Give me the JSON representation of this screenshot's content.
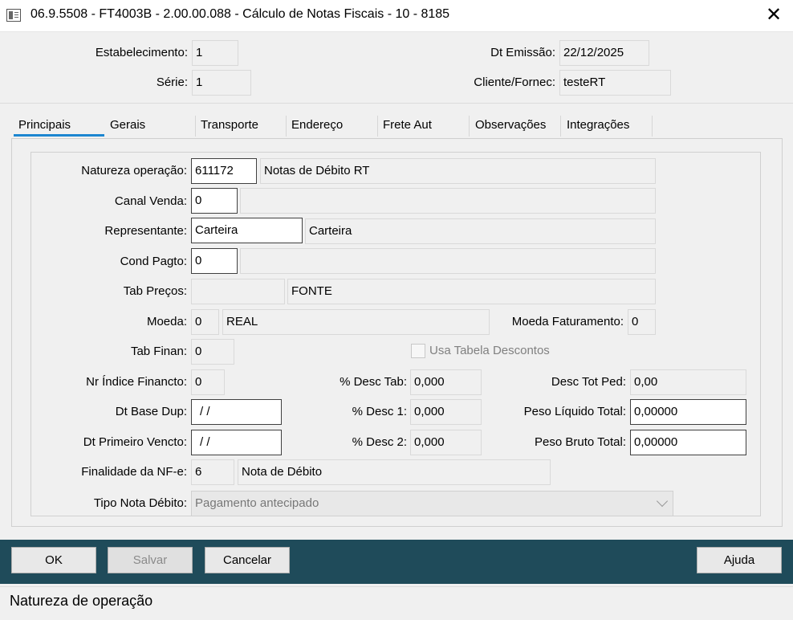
{
  "window": {
    "title": "06.9.5508 - FT4003B - 2.00.00.088 - Cálculo de Notas Fiscais - 10 - 8185",
    "close_glyph": "✕"
  },
  "header": {
    "estabelecimento_label": "Estabelecimento:",
    "estabelecimento_value": "1",
    "serie_label": "Série:",
    "serie_value": "1",
    "dt_emissao_label": "Dt Emissão:",
    "dt_emissao_value": "22/12/2025",
    "cliente_label": "Cliente/Fornec:",
    "cliente_value": "testeRT"
  },
  "tabs": [
    {
      "label": "Principais",
      "active": true
    },
    {
      "label": "Gerais"
    },
    {
      "label": "Transporte"
    },
    {
      "label": "Endereço"
    },
    {
      "label": "Frete Aut"
    },
    {
      "label": "Observações"
    },
    {
      "label": "Integrações"
    }
  ],
  "form": {
    "natureza_label": "Natureza operação:",
    "natureza_code": "611172",
    "natureza_desc": "Notas de Débito RT",
    "canal_label": "Canal Venda:",
    "canal_code": "0",
    "canal_desc": "",
    "representante_label": "Representante:",
    "representante_code": "Carteira",
    "representante_desc": "Carteira",
    "cond_label": "Cond Pagto:",
    "cond_code": "0",
    "cond_desc": "",
    "tab_precos_label": "Tab Preços:",
    "tab_precos_code": "",
    "tab_precos_desc": "FONTE",
    "moeda_label": "Moeda:",
    "moeda_code": "0",
    "moeda_desc": "REAL",
    "moeda_fat_label": "Moeda Faturamento:",
    "moeda_fat_value": "0",
    "tab_finan_label": "Tab Finan:",
    "tab_finan_value": "0",
    "usa_tabela_label": "Usa Tabela Descontos",
    "nr_indice_label": "Nr Índice Financto:",
    "nr_indice_value": "0",
    "desc_tab_label": "% Desc Tab:",
    "desc_tab_value": "0,000",
    "desc_tot_label": "Desc Tot Ped:",
    "desc_tot_value": "0,00",
    "dt_base_label": "Dt Base Dup:",
    "dt_base_value": " / /",
    "desc1_label": "% Desc 1:",
    "desc1_value": "0,000",
    "peso_liq_label": "Peso Líquido Total:",
    "peso_liq_value": "0,00000",
    "dt_primeiro_label": "Dt Primeiro Vencto:",
    "dt_primeiro_value": " / /",
    "desc2_label": "% Desc 2:",
    "desc2_value": "0,000",
    "peso_bruto_label": "Peso Bruto Total:",
    "peso_bruto_value": "0,00000",
    "finalidade_label": "Finalidade da NF-e:",
    "finalidade_code": "6",
    "finalidade_desc": "Nota de Débito",
    "tipo_nota_label": "Tipo Nota Débito:",
    "tipo_nota_value": "Pagamento antecipado"
  },
  "buttons": {
    "ok": "OK",
    "salvar": "Salvar",
    "cancelar": "Cancelar",
    "ajuda": "Ajuda"
  },
  "status": {
    "text": "Natureza de operação"
  },
  "colors": {
    "button_bar": "#1f4b5a",
    "active_tab_underline": "#1c86d0"
  }
}
